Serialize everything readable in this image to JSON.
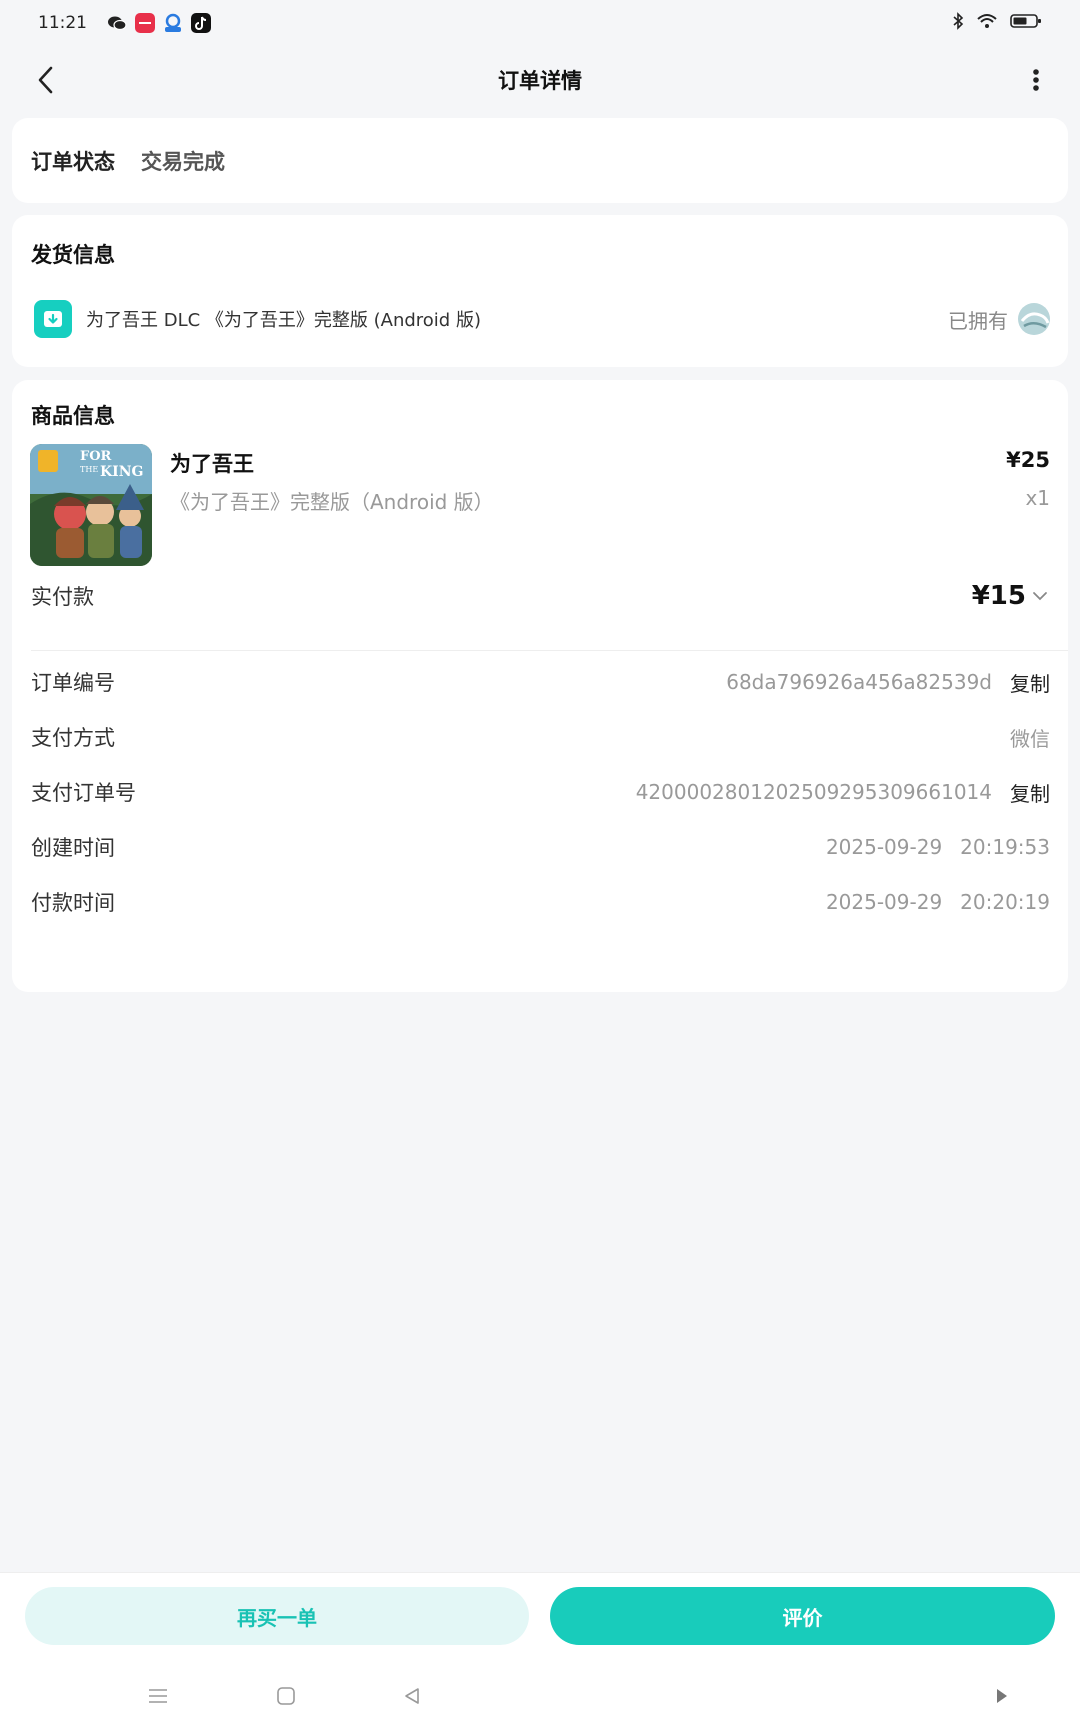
{
  "status_bar": {
    "time": "11:21",
    "notification_icons": [
      "wechat-icon",
      "app-red-icon",
      "app-blue-icon",
      "tiktok-icon"
    ],
    "right_icons": [
      "bluetooth-icon",
      "wifi-icon",
      "battery-icon"
    ]
  },
  "nav": {
    "title": "订单详情"
  },
  "order_status": {
    "label": "订单状态",
    "value": "交易完成"
  },
  "shipping": {
    "title": "发货信息",
    "item_name": "为了吾王 DLC 《为了吾王》完整版 (Android 版)",
    "owned_label": "已拥有"
  },
  "goods": {
    "title": "商品信息",
    "thumb_caption_top": "FOR",
    "thumb_caption_mid": "THE",
    "thumb_caption_bottom": "KING",
    "name": "为了吾王",
    "subtitle": "《为了吾王》完整版（Android 版）",
    "price": "¥25",
    "quantity": "x1",
    "paid_label": "实付款",
    "paid_amount": "¥15"
  },
  "order_info": {
    "order_no_label": "订单编号",
    "order_no": "68da796926a456a82539d",
    "copy_label": "复制",
    "pay_method_label": "支付方式",
    "pay_method": "微信",
    "pay_order_no_label": "支付订单号",
    "pay_order_no": "4200002801202509295309661014",
    "created_label": "创建时间",
    "created_date": "2025-09-29",
    "created_time": "20:19:53",
    "paid_time_label": "付款时间",
    "paid_date": "2025-09-29",
    "paid_time": "20:20:19"
  },
  "actions": {
    "rebuy": "再买一单",
    "review": "评价"
  },
  "colors": {
    "accent": "#18ccbb",
    "accent_light": "#e3f7f6",
    "background": "#f5f6f8"
  }
}
